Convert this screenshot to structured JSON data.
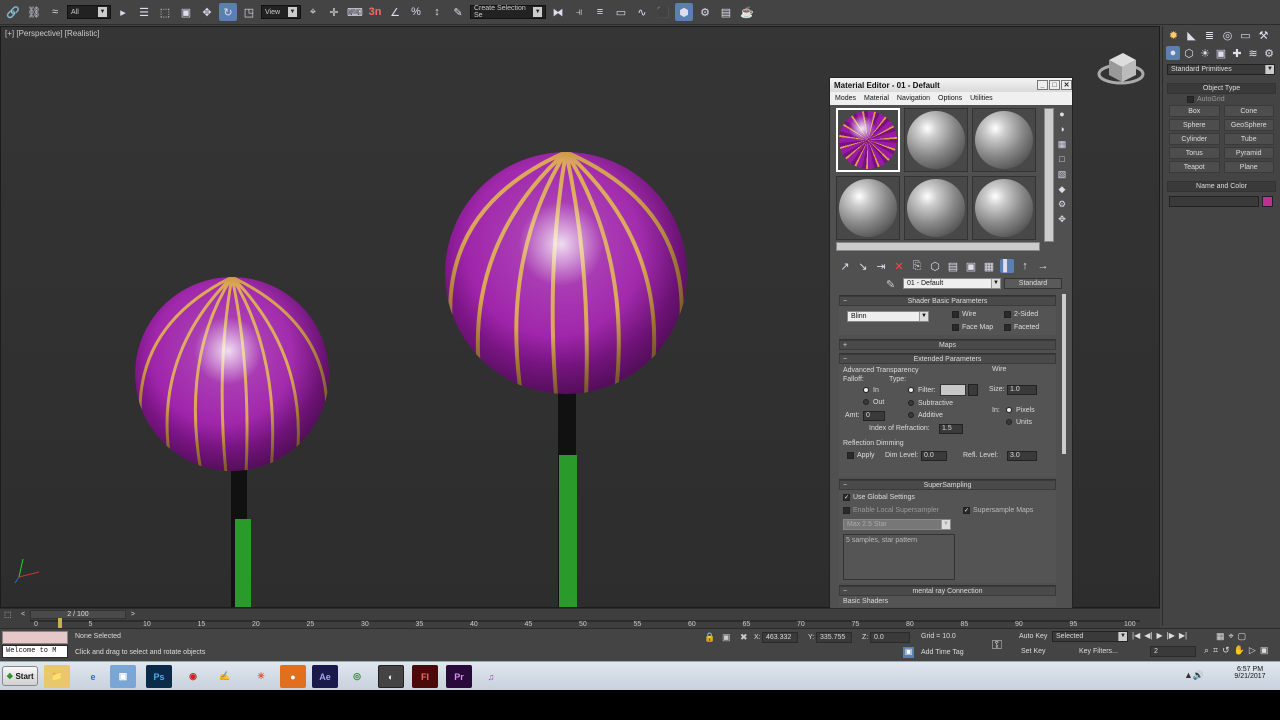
{
  "toolbar": {
    "filter_value": "All",
    "ref_coord_value": "View",
    "snap_label": "3n",
    "named_sel_placeholder": "Create Selection Se"
  },
  "viewport": {
    "label": "[+] [Perspective] [Realistic]"
  },
  "material_editor": {
    "title": "Material Editor - 01 - Default",
    "menu": [
      "Modes",
      "Material",
      "Navigation",
      "Options",
      "Utilities"
    ],
    "material_name": "01 - Default",
    "material_type": "Standard",
    "shader_basic": {
      "header": "Shader Basic Parameters",
      "shader": "Blinn",
      "wire": "Wire",
      "two_sided": "2-Sided",
      "face_map": "Face Map",
      "faceted": "Faceted"
    },
    "maps_header": "Maps",
    "extended": {
      "header": "Extended Parameters",
      "adv_transparency": "Advanced Transparency",
      "falloff": "Falloff:",
      "type": "Type:",
      "in": "In",
      "out": "Out",
      "amt": "Amt:",
      "amt_value": "0",
      "filter": "Filter:",
      "subtractive": "Subtractive",
      "additive": "Additive",
      "ior_label": "Index of Refraction:",
      "ior_value": "1.5",
      "wire_group": "Wire",
      "size_label": "Size:",
      "size_value": "1.0",
      "in_label": "In:",
      "pixels": "Pixels",
      "units": "Units",
      "refl_dimming": "Reflection Dimming",
      "apply": "Apply",
      "dim_level": "Dim Level:",
      "dim_value": "0.0",
      "refl_level": "Refl. Level:",
      "refl_value": "3.0"
    },
    "supersampling": {
      "header": "SuperSampling",
      "use_global": "Use Global Settings",
      "enable_local": "Enable Local Supersampler",
      "ss_maps": "Supersample Maps",
      "sampler": "Max 2.5 Star",
      "description": "5 samples, star pattern"
    },
    "mental_ray": {
      "header": "mental ray Connection",
      "basic_shaders": "Basic Shaders"
    }
  },
  "command_panel": {
    "category": "Standard Primitives",
    "object_type_header": "Object Type",
    "autogrid": "AutoGrid",
    "objects": [
      "Box",
      "Cone",
      "Sphere",
      "GeoSphere",
      "Cylinder",
      "Tube",
      "Torus",
      "Pyramid",
      "Teapot",
      "Plane"
    ],
    "name_color_header": "Name and Color",
    "object_color": "#c03090"
  },
  "timeline": {
    "frame": "2 / 100",
    "ticks": [
      "0",
      "5",
      "10",
      "15",
      "20",
      "25",
      "30",
      "35",
      "40",
      "45",
      "50",
      "55",
      "60",
      "65",
      "70",
      "75",
      "80",
      "85",
      "90",
      "95",
      "100"
    ]
  },
  "status": {
    "maxscript": "Welcome to M",
    "selection": "None Selected",
    "prompt": "Click and drag to select and rotate objects",
    "x_label": "X:",
    "x_value": "463.332",
    "y_label": "Y:",
    "y_value": "335.755",
    "z_label": "Z:",
    "z_value": "0.0",
    "grid": "Grid = 10.0",
    "add_time_tag": "Add Time Tag",
    "auto_key": "Auto Key",
    "set_key": "Set Key",
    "selected": "Selected",
    "key_filters": "Key Filters...",
    "frame_value": "2"
  },
  "taskbar": {
    "start": "Start",
    "time": "6:57 PM",
    "date": "9/21/2017",
    "apps": [
      "Ps",
      "Ae",
      "Fl",
      "Pr"
    ]
  }
}
